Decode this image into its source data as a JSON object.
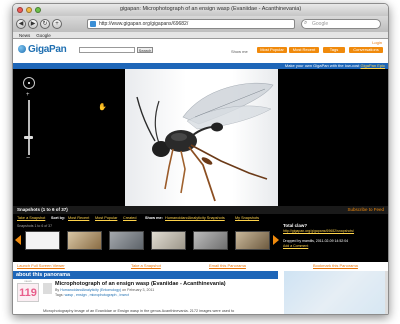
{
  "window": {
    "title": "gigapan: Microphotograph of an ensign wasp (Evaniidae - Acanthinevania)"
  },
  "toolbar": {
    "url": "http://www.gigapan.org/gigapans/69682/",
    "search_placeholder": "Google"
  },
  "bookmarks": [
    "News",
    "Google"
  ],
  "header": {
    "logo": "GigaPan",
    "search_button": "Search",
    "login": "Login",
    "show_me": "Show me",
    "tabs": [
      "Most Popular",
      "Most Recent",
      "Tags",
      "Conversations"
    ]
  },
  "viewer_bar": {
    "text": "Make your own GigaPan with the low-cost",
    "link": "GigaPan Epic"
  },
  "snapshots": {
    "heading": "Snapshots (1 to 6 of 37)",
    "rss": "Subscribe to Feed",
    "take_snapshot": "Take a Snapshot",
    "sort_label": "Sort by:",
    "sort_recent": "Most Recent",
    "sort_popular": "Most Popular",
    "sort_created": "Created",
    "show_label": "Show me:",
    "show_all": "HumanoidandAnalyticity Snapshots",
    "show_mine": "My Snapshots",
    "count": "Snapshots 1 to 6 of 37",
    "captions": [
      "Left to Full Screen Viewer",
      "",
      "Take a Snapshot",
      "",
      "",
      ""
    ],
    "side_title": "Total claw?",
    "side_link": "http://gigapan.org/gigapans/69682/snapshots/",
    "side_meta": "Dropped by mamills, 2011-02-09 14:52:04",
    "side_action": "Add a Comment"
  },
  "links_row": [
    "Launch Full Screen Viewer",
    "Take a Snapshot",
    "Email this Panorama",
    "Bookmark this Panorama"
  ],
  "about": {
    "heading": "about this panorama",
    "views_label": "views",
    "views": "119",
    "title": "Microphotograph of an ensign wasp (Evaniidae - Acanthinevania)",
    "by_label": "By",
    "author": "HumanoidandAnalyticity (Entomology)",
    "date": "on February 3, 2011",
    "tags_label": "Tags:",
    "tags": "wasp , ensign , microphotograph , insect",
    "description": "Microphotography image of an Evaniidae or Ensign wasp in the genus Acanthinevania. 2172 images were used to"
  },
  "colors": {
    "brand_blue": "#1e66b8",
    "orange": "#f08a0c",
    "link_yellow": "#ffd34a"
  }
}
